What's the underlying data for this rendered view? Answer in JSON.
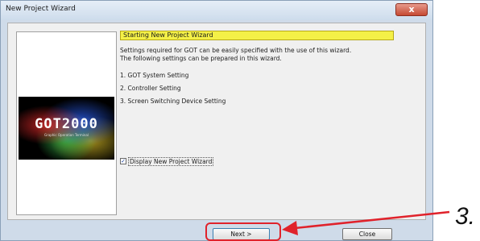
{
  "window": {
    "title": "New Project Wizard",
    "close_glyph": "x"
  },
  "logo": {
    "text": "GOT2000",
    "subtitle": "Graphic Operation Terminal"
  },
  "wizard": {
    "heading": "Starting New Project Wizard",
    "desc_line1": "Settings required for GOT can be easily specified with the use of this wizard.",
    "desc_line2": "The following settings can be prepared in this wizard.",
    "steps": [
      "1. GOT System Setting",
      "2. Controller Setting",
      "3. Screen Switching Device Setting"
    ],
    "checkbox_label": "Display New Project Wizard",
    "checkbox_checked": true
  },
  "buttons": {
    "next": "Next >",
    "close": "Close"
  },
  "callout": {
    "label": "3.",
    "color": "#e0222b"
  }
}
